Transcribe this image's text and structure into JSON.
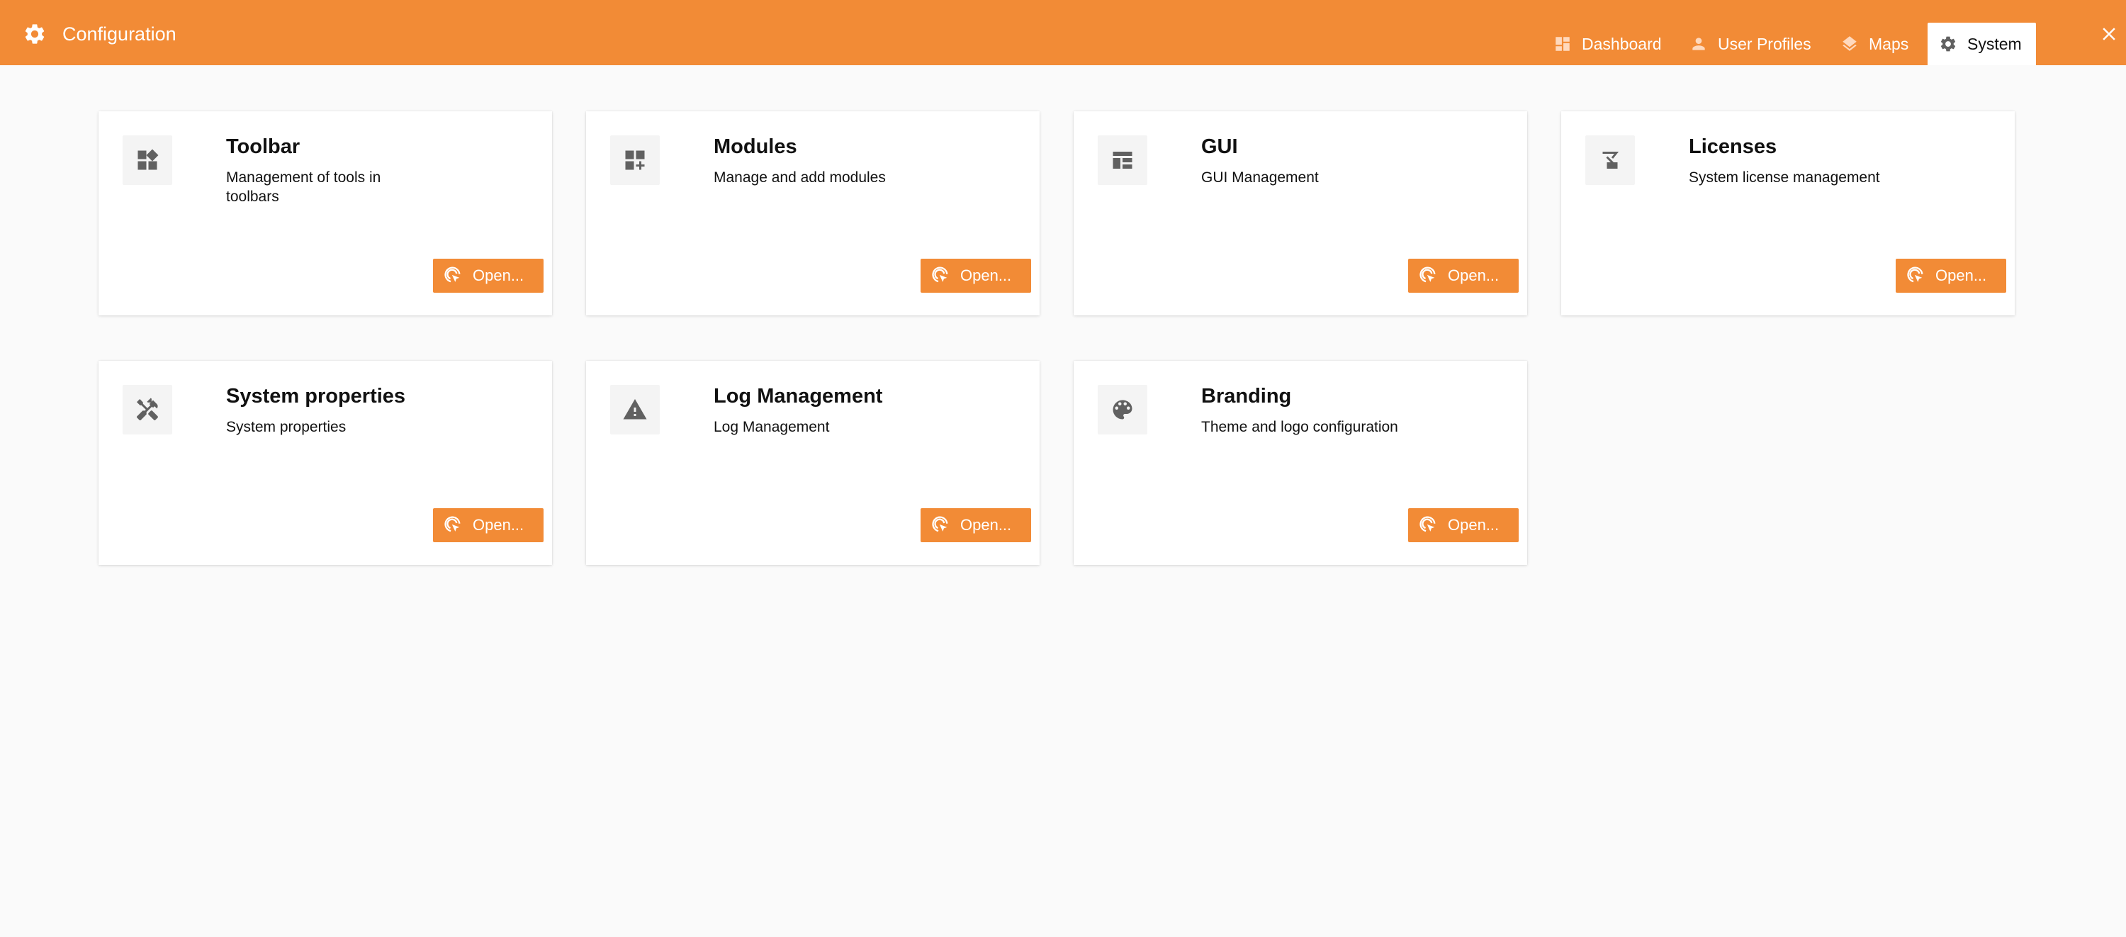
{
  "app": {
    "title": "Configuration",
    "icon": "gear-icon"
  },
  "nav": {
    "tabs": [
      {
        "label": "Dashboard",
        "icon": "dashboard-icon",
        "active": false
      },
      {
        "label": "User Profiles",
        "icon": "user-icon",
        "active": false
      },
      {
        "label": "Maps",
        "icon": "layers-icon",
        "active": false
      },
      {
        "label": "System",
        "icon": "gear-icon",
        "active": true
      }
    ],
    "close_icon": "close-icon"
  },
  "cards": [
    {
      "title": "Toolbar",
      "description": "Management of tools in toolbars",
      "icon": "widgets-icon",
      "button": "Open..."
    },
    {
      "title": "Modules",
      "description": "Manage and add modules",
      "icon": "add-module-icon",
      "button": "Open..."
    },
    {
      "title": "GUI",
      "description": "GUI Management",
      "icon": "layout-icon",
      "button": "Open..."
    },
    {
      "title": "Licenses",
      "description": "System license management",
      "icon": "license-icon",
      "button": "Open..."
    },
    {
      "title": "System properties",
      "description": "System properties",
      "icon": "tools-icon",
      "button": "Open..."
    },
    {
      "title": "Log Management",
      "description": "Log Management",
      "icon": "warning-icon",
      "button": "Open..."
    },
    {
      "title": "Branding",
      "description": "Theme and logo configuration",
      "icon": "palette-icon",
      "button": "Open..."
    }
  ],
  "colors": {
    "accent": "#f28b36",
    "background": "#fafafa",
    "card": "#ffffff",
    "icon_gray": "#616161"
  }
}
